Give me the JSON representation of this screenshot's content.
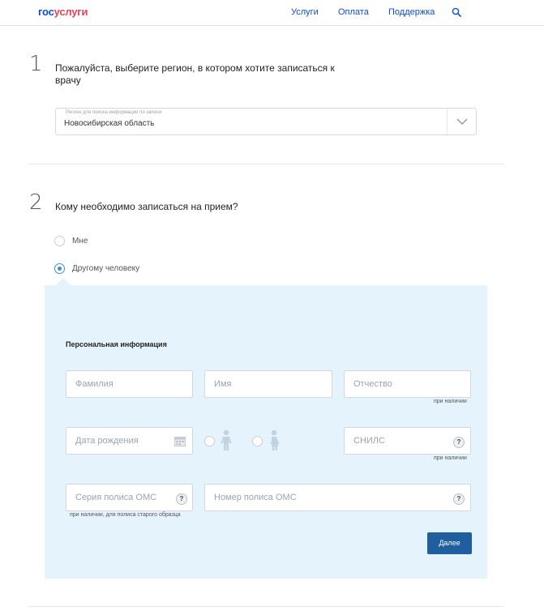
{
  "header": {
    "logo_part1": "гос",
    "logo_part2": "услуги",
    "nav": [
      "Услуги",
      "Оплата",
      "Поддержка"
    ]
  },
  "step1": {
    "number": "1",
    "title": "Пожалуйста, выберите регион, в котором хотите записаться к врачу",
    "select_caption": "Регион для поиска информации по записи",
    "select_value": "Новосибирская область"
  },
  "step2": {
    "number": "2",
    "title": "Кому необходимо записаться на прием?",
    "options": [
      "Мне",
      "Другому человеку"
    ],
    "selected": "Другому человеку"
  },
  "panel": {
    "title": "Персональная информация",
    "last_name_placeholder": "Фамилия",
    "first_name_placeholder": "Имя",
    "middle_name_placeholder": "Отчество",
    "middle_name_hint": "при наличии",
    "birth_date_placeholder": "Дата рождения",
    "snils_placeholder": "СНИЛС",
    "snils_hint": "при наличии",
    "oms_series_placeholder": "Серия полиса ОМС",
    "oms_series_hint": "при наличии, для полиса старого образца",
    "oms_number_placeholder": "Номер полиса ОМС",
    "help_symbol": "?",
    "submit_label": "Далее"
  },
  "colors": {
    "brand_blue": "#0d4cd3",
    "brand_red": "#ee3f58",
    "panel_bg": "#e5f3fc",
    "button_bg": "#1f5fa0",
    "radio_active": "#3b8fd6"
  }
}
